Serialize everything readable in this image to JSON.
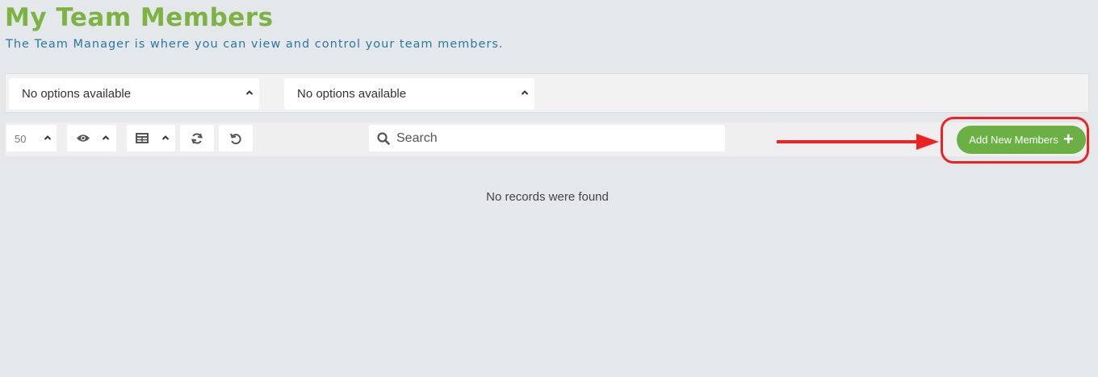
{
  "header": {
    "title": "My Team Members",
    "subtitle": "The Team Manager is where you can view and control your team members."
  },
  "filters": [
    {
      "value": "No options available"
    },
    {
      "value": "No options available"
    }
  ],
  "toolbar": {
    "page_size": "50",
    "search_placeholder": "Search",
    "add_button_label": "Add New Members",
    "add_button_icon": "+"
  },
  "table": {
    "empty_message": "No records were found"
  },
  "colors": {
    "title": "#7cb342",
    "subtitle": "#2a78a8",
    "accent_button": "#6ab044",
    "annotation": "#ee2222"
  },
  "icons": [
    "chevron-up-icon",
    "eye-icon",
    "table-icon",
    "refresh-icon",
    "undo-icon",
    "search-icon",
    "plus-icon",
    "arrow-right-icon"
  ]
}
